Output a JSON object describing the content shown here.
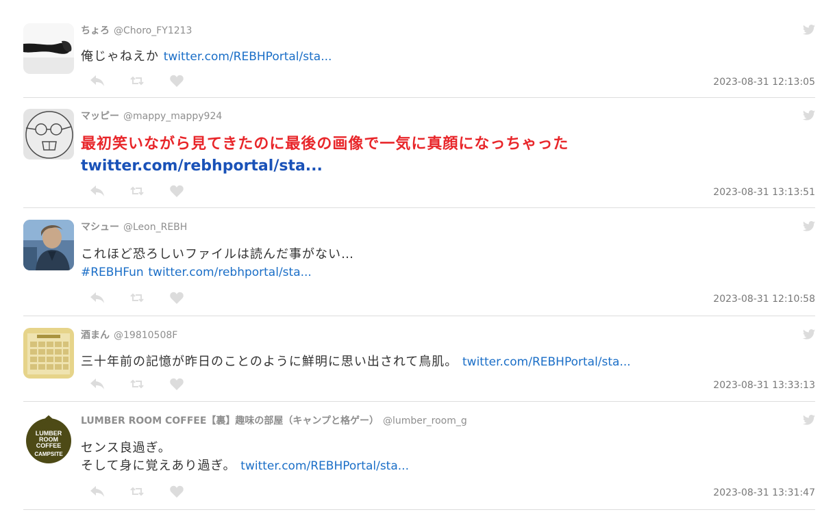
{
  "tweets": [
    {
      "name": "ちょろ",
      "handle": "@Choro_FY1213",
      "text": "俺じゃねえか",
      "link": "twitter.com/REBHPortal/sta...",
      "time": "2023-08-31 12:13:05"
    },
    {
      "name": "マッピー",
      "handle": "@mappy_mappy924",
      "text": "最初笑いながら見てきたのに最後の画像で一気に真顔になっちゃった",
      "link": "twitter.com/rebhportal/sta...",
      "time": "2023-08-31 13:13:51"
    },
    {
      "name": "マシュー",
      "handle": "@Leon_REBH",
      "text": "これほど恐ろしいファイルは読んだ事がない…",
      "hashtag": "#REBHFun",
      "link": "twitter.com/rebhportal/sta...",
      "time": "2023-08-31 12:10:58"
    },
    {
      "name": "酒まん",
      "handle": "@19810508F",
      "text": "三十年前の記憶が昨日のことのように鮮明に思い出されて鳥肌。",
      "link": "twitter.com/REBHPortal/sta...",
      "time": "2023-08-31 13:33:13"
    },
    {
      "name": "LUMBER ROOM COFFEE【裏】趣味の部屋（キャンプと格ゲー）",
      "handle": "@lumber_room_g",
      "text_line1": "センス良過ぎ。",
      "text_line2": "そして身に覚えあり過ぎ。",
      "link": "twitter.com/REBHPortal/sta...",
      "time": "2023-08-31 13:31:47",
      "avatar_text": [
        "LUMBER",
        "ROOM",
        "COFFEE",
        "CAMPSITE"
      ]
    }
  ],
  "icons": {
    "reply": "reply-icon",
    "retweet": "retweet-icon",
    "like": "heart-icon",
    "bird": "twitter-bird-icon"
  },
  "colors": {
    "link": "#1a6ec7",
    "highlight_red": "#e8262a",
    "highlight_link": "#1a52b8",
    "icon_gray": "#dcdcdc",
    "meta_gray": "#8e8e8e"
  }
}
